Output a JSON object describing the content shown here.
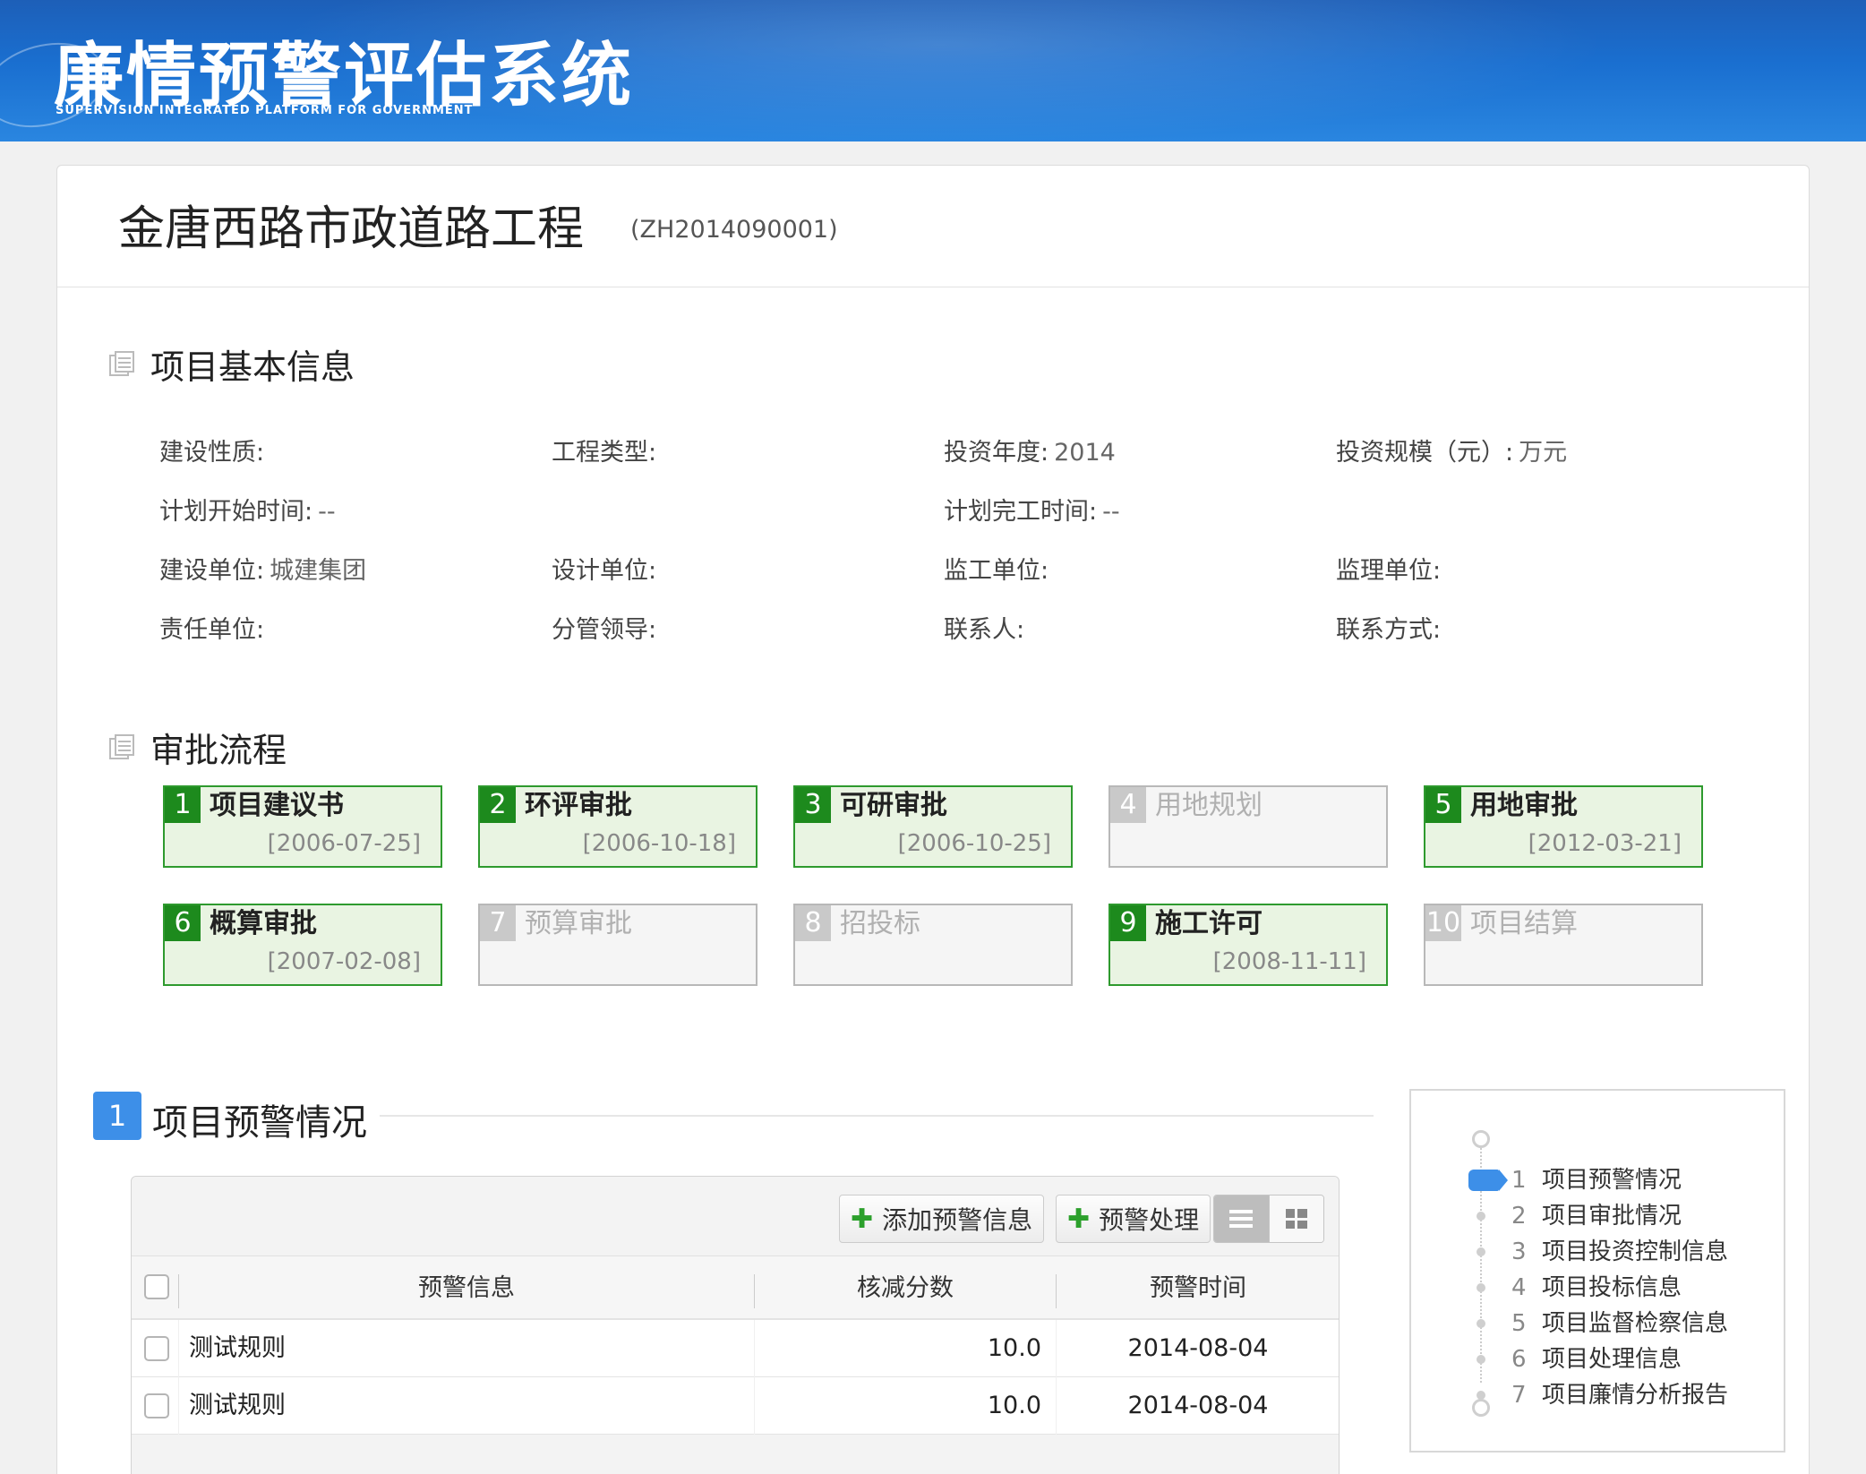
{
  "header": {
    "title": "廉情预警评估系统",
    "subtitle": "SUPERVISION INTEGRATED PLATFORM FOR GOVERNMENT"
  },
  "project": {
    "name": "金唐西路市政道路工程",
    "code": "(ZH2014090001)"
  },
  "basic_info": {
    "section_title": "项目基本信息",
    "fields": [
      {
        "label": "建设性质:",
        "value": ""
      },
      {
        "label": "工程类型:",
        "value": ""
      },
      {
        "label": "投资年度:",
        "value": "2014"
      },
      {
        "label": "投资规模（元）:",
        "value": "万元"
      },
      {
        "label": "计划开始时间:",
        "value": "--"
      },
      {
        "label": "计划完工时间:",
        "value": "--"
      },
      {
        "label": "建设单位:",
        "value": "城建集团"
      },
      {
        "label": "设计单位:",
        "value": ""
      },
      {
        "label": "监工单位:",
        "value": ""
      },
      {
        "label": "监理单位:",
        "value": ""
      },
      {
        "label": "责任单位:",
        "value": ""
      },
      {
        "label": "分管领导:",
        "value": ""
      },
      {
        "label": "联系人:",
        "value": ""
      },
      {
        "label": "联系方式:",
        "value": ""
      }
    ]
  },
  "approval": {
    "section_title": "审批流程",
    "steps": [
      {
        "num": "1",
        "name": "项目建议书",
        "date": "[2006-07-25]",
        "done": true
      },
      {
        "num": "2",
        "name": "环评审批",
        "date": "[2006-10-18]",
        "done": true
      },
      {
        "num": "3",
        "name": "可研审批",
        "date": "[2006-10-25]",
        "done": true
      },
      {
        "num": "4",
        "name": "用地规划",
        "date": "",
        "done": false
      },
      {
        "num": "5",
        "name": "用地审批",
        "date": "[2012-03-21]",
        "done": true
      },
      {
        "num": "6",
        "name": "概算审批",
        "date": "[2007-02-08]",
        "done": true
      },
      {
        "num": "7",
        "name": "预算审批",
        "date": "",
        "done": false
      },
      {
        "num": "8",
        "name": "招投标",
        "date": "",
        "done": false
      },
      {
        "num": "9",
        "name": "施工许可",
        "date": "[2008-11-11]",
        "done": true
      },
      {
        "num": "10",
        "name": "项目结算",
        "date": "",
        "done": false
      }
    ]
  },
  "warnings": {
    "badge": "1",
    "section_title": "项目预警情况",
    "toolbar": {
      "add_label": "添加预警信息",
      "handle_label": "预警处理",
      "view_mode": "list"
    },
    "columns": [
      "预警信息",
      "核减分数",
      "预警时间"
    ],
    "rows": [
      {
        "info": "测试规则",
        "score": "10.0",
        "time": "2014-08-04"
      },
      {
        "info": "测试规则",
        "score": "10.0",
        "time": "2014-08-04"
      }
    ]
  },
  "side_nav": {
    "active_index": 0,
    "items": [
      {
        "num": "1",
        "label": "项目预警情况"
      },
      {
        "num": "2",
        "label": "项目审批情况"
      },
      {
        "num": "3",
        "label": "项目投资控制信息"
      },
      {
        "num": "4",
        "label": "项目投标信息"
      },
      {
        "num": "5",
        "label": "项目监督检察信息"
      },
      {
        "num": "6",
        "label": "项目处理信息"
      },
      {
        "num": "7",
        "label": "项目廉情分析报告"
      }
    ]
  },
  "colors": {
    "brand_blue": "#3d8fe8",
    "step_done_green": "#1d8a1d",
    "step_done_bg": "#e9f4e2",
    "add_icon_green": "#2ca02c"
  }
}
